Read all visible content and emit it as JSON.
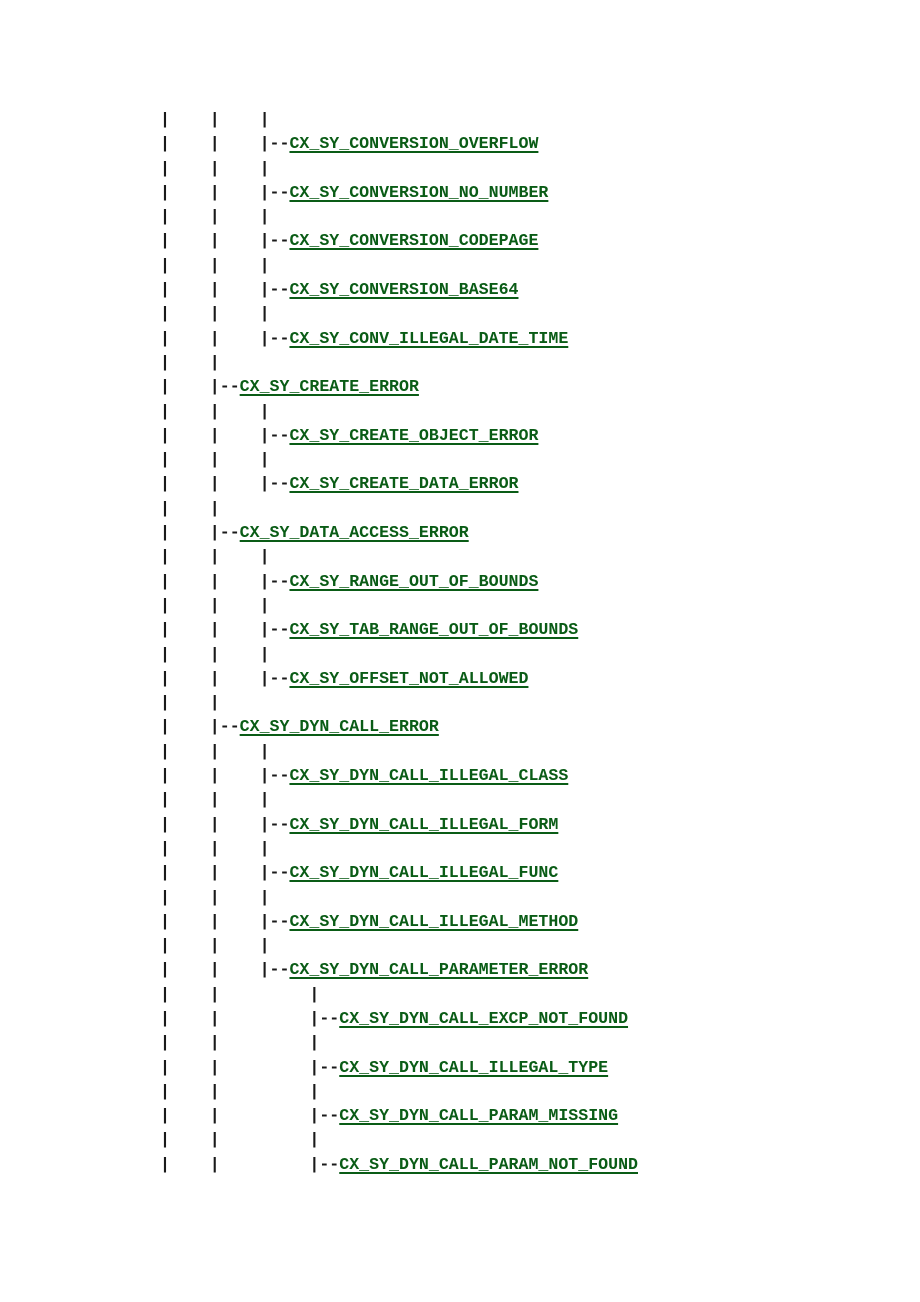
{
  "page": {
    "title": "ABAP Exception Class Hierarchy",
    "link_color": "#0a5c16",
    "rule_color": "#1a1a1a",
    "background_color": "#ffffff",
    "indent_unit": "     ",
    "branch_prefix": "|--",
    "pipe": "|"
  },
  "tree": {
    "lines": [
      {
        "rule": "|    |    |",
        "node": ""
      },
      {
        "rule": "|    |    |--",
        "node": "CX_SY_CONVERSION_OVERFLOW"
      },
      {
        "rule": "|    |    |",
        "node": ""
      },
      {
        "rule": "|    |    |--",
        "node": "CX_SY_CONVERSION_NO_NUMBER"
      },
      {
        "rule": "|    |    |",
        "node": ""
      },
      {
        "rule": "|    |    |--",
        "node": "CX_SY_CONVERSION_CODEPAGE"
      },
      {
        "rule": "|    |    |",
        "node": ""
      },
      {
        "rule": "|    |    |--",
        "node": "CX_SY_CONVERSION_BASE64"
      },
      {
        "rule": "|    |    |",
        "node": ""
      },
      {
        "rule": "|    |    |--",
        "node": "CX_SY_CONV_ILLEGAL_DATE_TIME"
      },
      {
        "rule": "|    |",
        "node": ""
      },
      {
        "rule": "|    |--",
        "node": "CX_SY_CREATE_ERROR"
      },
      {
        "rule": "|    |    |",
        "node": ""
      },
      {
        "rule": "|    |    |--",
        "node": "CX_SY_CREATE_OBJECT_ERROR"
      },
      {
        "rule": "|    |    |",
        "node": ""
      },
      {
        "rule": "|    |    |--",
        "node": "CX_SY_CREATE_DATA_ERROR"
      },
      {
        "rule": "|    |",
        "node": ""
      },
      {
        "rule": "|    |--",
        "node": "CX_SY_DATA_ACCESS_ERROR"
      },
      {
        "rule": "|    |    |",
        "node": ""
      },
      {
        "rule": "|    |    |--",
        "node": "CX_SY_RANGE_OUT_OF_BOUNDS"
      },
      {
        "rule": "|    |    |",
        "node": ""
      },
      {
        "rule": "|    |    |--",
        "node": "CX_SY_TAB_RANGE_OUT_OF_BOUNDS"
      },
      {
        "rule": "|    |    |",
        "node": ""
      },
      {
        "rule": "|    |    |--",
        "node": "CX_SY_OFFSET_NOT_ALLOWED"
      },
      {
        "rule": "|    |",
        "node": ""
      },
      {
        "rule": "|    |--",
        "node": "CX_SY_DYN_CALL_ERROR"
      },
      {
        "rule": "|    |    |",
        "node": ""
      },
      {
        "rule": "|    |    |--",
        "node": "CX_SY_DYN_CALL_ILLEGAL_CLASS"
      },
      {
        "rule": "|    |    |",
        "node": ""
      },
      {
        "rule": "|    |    |--",
        "node": "CX_SY_DYN_CALL_ILLEGAL_FORM"
      },
      {
        "rule": "|    |    |",
        "node": ""
      },
      {
        "rule": "|    |    |--",
        "node": "CX_SY_DYN_CALL_ILLEGAL_FUNC"
      },
      {
        "rule": "|    |    |",
        "node": ""
      },
      {
        "rule": "|    |    |--",
        "node": "CX_SY_DYN_CALL_ILLEGAL_METHOD"
      },
      {
        "rule": "|    |    |",
        "node": ""
      },
      {
        "rule": "|    |    |--",
        "node": "CX_SY_DYN_CALL_PARAMETER_ERROR"
      },
      {
        "rule": "|    |         |",
        "node": ""
      },
      {
        "rule": "|    |         |--",
        "node": "CX_SY_DYN_CALL_EXCP_NOT_FOUND"
      },
      {
        "rule": "|    |         |",
        "node": ""
      },
      {
        "rule": "|    |         |--",
        "node": "CX_SY_DYN_CALL_ILLEGAL_TYPE"
      },
      {
        "rule": "|    |         |",
        "node": ""
      },
      {
        "rule": "|    |         |--",
        "node": "CX_SY_DYN_CALL_PARAM_MISSING"
      },
      {
        "rule": "|    |         |",
        "node": ""
      },
      {
        "rule": "|    |         |--",
        "node": "CX_SY_DYN_CALL_PARAM_NOT_FOUND"
      }
    ]
  }
}
